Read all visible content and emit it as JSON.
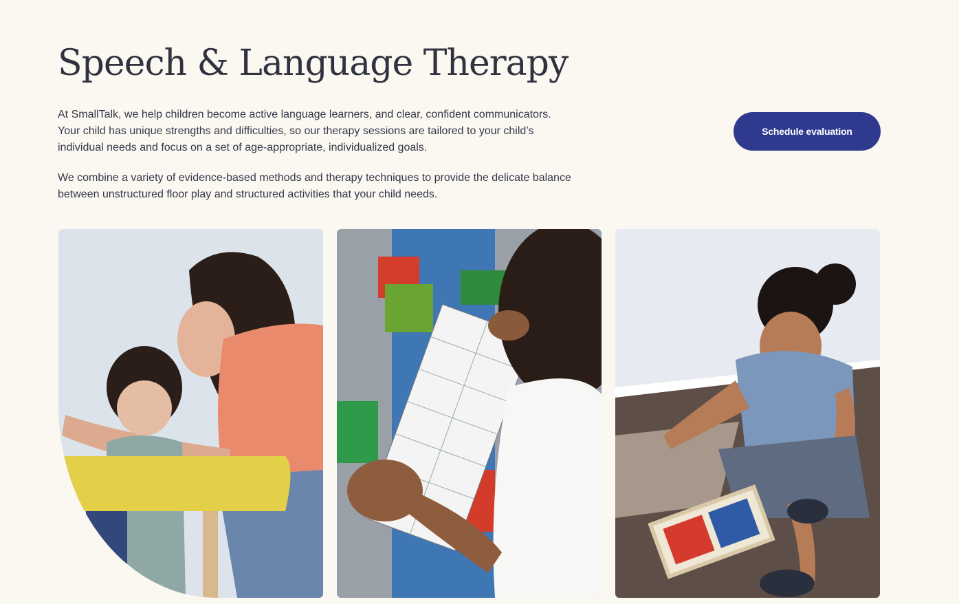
{
  "header": {
    "title": "Speech & Language Therapy"
  },
  "intro": {
    "paragraph_1": "At SmallTalk, we help children become active language learners, and clear, confident communicators. Your child has unique strengths and difficulties, so our therapy sessions are tailored to your child’s individual needs and focus on a set of age-appropriate, individualized goals.",
    "paragraph_2": "We combine a variety of evidence-based methods and therapy techniques to provide the delicate balance between unstructured floor play and structured activities that your child needs."
  },
  "cta": {
    "label": "Schedule evaluation"
  },
  "photos": [
    {
      "icon": "therapist-with-child-photo"
    },
    {
      "icon": "child-with-word-cards-photo"
    },
    {
      "icon": "child-playing-with-letters-photo"
    }
  ],
  "colors": {
    "background": "#fbf8f1",
    "heading": "#30323f",
    "button": "#2f3a8f"
  }
}
